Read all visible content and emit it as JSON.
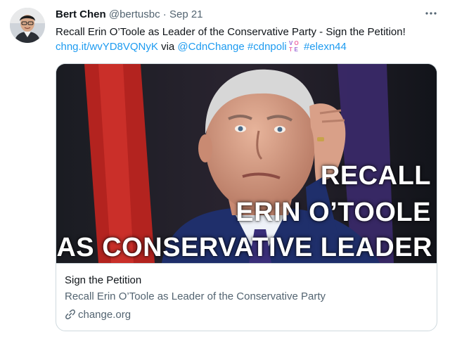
{
  "tweet": {
    "author": {
      "name": "Bert Chen",
      "handle": "@bertusbc",
      "separator": "·",
      "date": "Sep 21",
      "avatar_icon": "avatar-photo"
    },
    "text": {
      "line1": "Recall Erin O’Toole as Leader of the Conservative Party - Sign the Petition!",
      "short_link": "chng.it/wvYD8VQNyK",
      "via": "via",
      "mention": "@CdnChange",
      "hashtag1": "#cdnpoli",
      "vote_emoji": "vote-emoji",
      "hashtag2": "#elexn44"
    },
    "more_icon": "more-options-icon",
    "colors": {
      "link": "#1d9bf0",
      "secondary_text": "#536471",
      "border": "#cfd9de"
    }
  },
  "card": {
    "image": {
      "overlay_lines": [
        "RECALL",
        "ERIN O’TOOLE",
        "AS CONSERVATIVE LEADER"
      ]
    },
    "source_label": "Sign the Petition",
    "title": "Recall Erin O’Toole as Leader of the Conservative Party",
    "domain": "change.org",
    "domain_icon": "link-icon"
  }
}
